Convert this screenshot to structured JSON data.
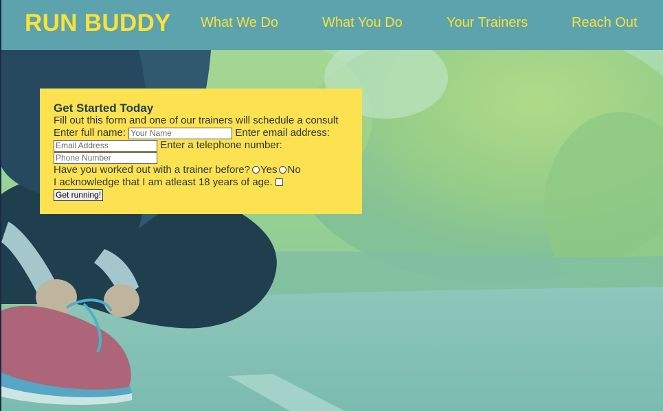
{
  "header": {
    "brand": "RUN BUDDY",
    "nav": [
      {
        "label": "What We Do"
      },
      {
        "label": "What You Do"
      },
      {
        "label": "Your Trainers"
      },
      {
        "label": "Reach Out"
      }
    ]
  },
  "form": {
    "title": "Get Started Today",
    "intro": "Fill out this form and one of our trainers will schedule a consult",
    "name_label": "Enter full name:",
    "name_placeholder": "Your Name",
    "email_label": "Enter email address:",
    "email_placeholder": "Email Address",
    "phone_label": "Enter a telephone number:",
    "phone_placeholder": "Phone Number",
    "trainer_question": "Have you worked out with a trainer before?",
    "option_yes": "Yes",
    "option_no": "No",
    "acknowledge": "I acknowledge that I am atleast 18 years of age.",
    "submit_label": "Get running!"
  },
  "colors": {
    "header_bg": "#5ca3ad",
    "accent": "#fce138",
    "form_bg": "#fce151"
  },
  "hero": {
    "image": "runner-tying-shoe-photo"
  }
}
